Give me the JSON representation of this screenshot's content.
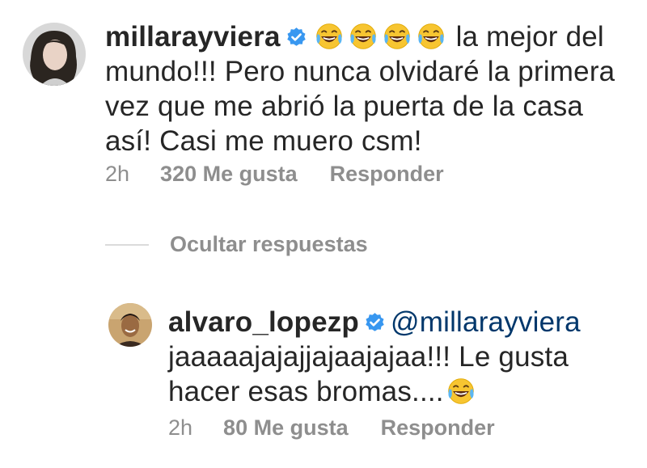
{
  "comments": {
    "main": {
      "username": "millarayviera",
      "text_after_emojis": " la mejor del mundo!!! Pero nunca olvidaré la primera vez que me abrió la puerta de la casa así! Casi me muero csm!",
      "emoji_icon": "laughing-crying-emoji",
      "emoji_count": 4,
      "time": "2h",
      "likes": "320 Me gusta",
      "reply_label": "Responder"
    },
    "hide_replies_label": "Ocultar respuestas",
    "reply": {
      "username": "alvaro_lopezp",
      "mention": "@millarayviera",
      "text": "jaaaaajajajjajaajajaa!!! Le gusta hacer esas bromas....",
      "emoji_icon": "laughing-crying-emoji",
      "time": "2h",
      "likes": "80 Me gusta",
      "reply_label": "Responder"
    }
  },
  "colors": {
    "text": "#262626",
    "meta": "#8e8e8e",
    "verified": "#3897f0",
    "mention": "#00376b",
    "divider": "#dbdbdb"
  }
}
